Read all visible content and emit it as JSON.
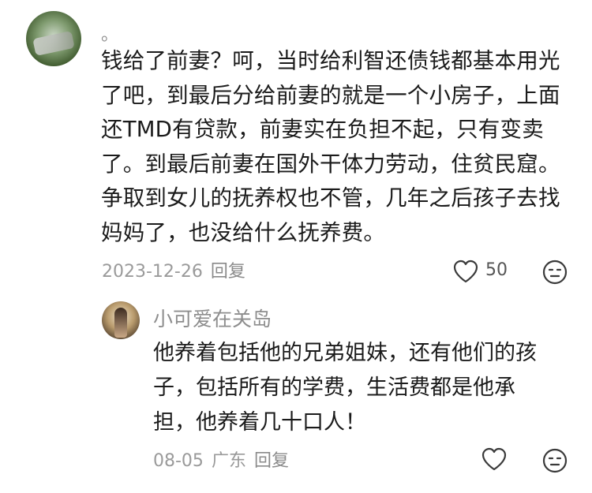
{
  "comment": {
    "username": "。",
    "text_lines": [
      "钱给了前妻？呵，当时给利智还债钱都基本用光",
      "了吧，到最后分给前妻的就是一个小房子，上面",
      "还TMD有贷款，前妻实在负担不起，只有变卖",
      "了。到最后前妻在国外干体力劳动，住贫民窟。",
      "争取到女儿的抚养权也不管，几年之后孩子去找",
      "妈妈了，也没给什么抚养费。"
    ],
    "date": "2023-12-26",
    "reply_label": "回复",
    "like_count": "50",
    "icons": [
      "avatar",
      "heart-icon",
      "emoji-icon"
    ]
  },
  "reply": {
    "username": "小可爱在关岛",
    "text_lines": [
      "他养着包括他的兄弟姐妹，还有他们的孩",
      "子，包括所有的学费，生活费都是他承",
      "担，他养着几十口人！"
    ],
    "date": "08-05",
    "region": "广东",
    "reply_label": "回复",
    "icons": [
      "avatar",
      "heart-icon",
      "emoji-icon"
    ]
  },
  "colors": {
    "text": "#1b1b1b",
    "meta": "#9a9a9a",
    "icon": "#3a3a3a"
  }
}
